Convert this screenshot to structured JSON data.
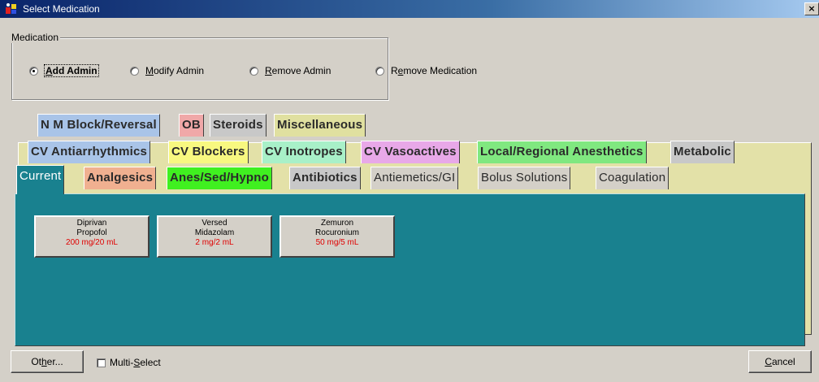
{
  "window": {
    "title": "Select Medication",
    "close_glyph": "×"
  },
  "medication_group": {
    "legend": "Medication",
    "options": [
      {
        "pre": "",
        "mn": "A",
        "post": "dd Admin",
        "selected": true
      },
      {
        "pre": "",
        "mn": "M",
        "post": "odify Admin",
        "selected": false
      },
      {
        "pre": "",
        "mn": "R",
        "post": "emove Admin",
        "selected": false
      },
      {
        "pre": "R",
        "mn": "e",
        "post": "move Medication",
        "selected": false
      }
    ]
  },
  "tabs": {
    "row1": [
      "N M Block/Reversal",
      "OB",
      "Steroids",
      "Miscellaneous"
    ],
    "row2": [
      "CV Antiarrhythmics",
      "CV Blockers",
      "CV Inotropes",
      "CV Vasoactives",
      "Local/Regional Anesthetics",
      "Metabolic"
    ],
    "row3": [
      "Current",
      "Analgesics",
      "Anes/Sed/Hypno",
      "Antibiotics",
      "Antiemetics/GI",
      "Bolus Solutions",
      "Coagulation"
    ],
    "active": "Current",
    "colors": {
      "N M Block/Reversal": "#a9c4e8",
      "OB": "#f0a8a8",
      "Steroids": "#c8c8c8",
      "Miscellaneous": "#e0e0a0",
      "CV Antiarrhythmics": "#a9c4e8",
      "CV Blockers": "#f8f880",
      "CV Inotropes": "#a8f0c8",
      "CV Vasoactives": "#e8a8e8",
      "Local/Regional Anesthetics": "#80e880",
      "Metabolic": "#c8c8c8",
      "Current": "#19818f",
      "Analgesics": "#f0b090",
      "Anes/Sed/Hypno": "#40f020",
      "Antibiotics": "#c8c8c8",
      "Antiemetics/GI": "#d4d0c8",
      "Bolus Solutions": "#d4d0c8",
      "Coagulation": "#d4d0c8"
    }
  },
  "medications": [
    {
      "brand": "Diprivan",
      "generic": "Propofol",
      "dose": "200 mg/20 mL"
    },
    {
      "brand": "Versed",
      "generic": "Midazolam",
      "dose": "2 mg/2 mL"
    },
    {
      "brand": "Zemuron",
      "generic": "Rocuronium",
      "dose": "50 mg/5 mL"
    }
  ],
  "footer": {
    "other": {
      "pre": "Ot",
      "mn": "h",
      "post": "er..."
    },
    "multi_select": {
      "pre": "Multi-",
      "mn": "S",
      "post": "elect"
    },
    "cancel": {
      "pre": "",
      "mn": "C",
      "post": "ancel"
    }
  }
}
